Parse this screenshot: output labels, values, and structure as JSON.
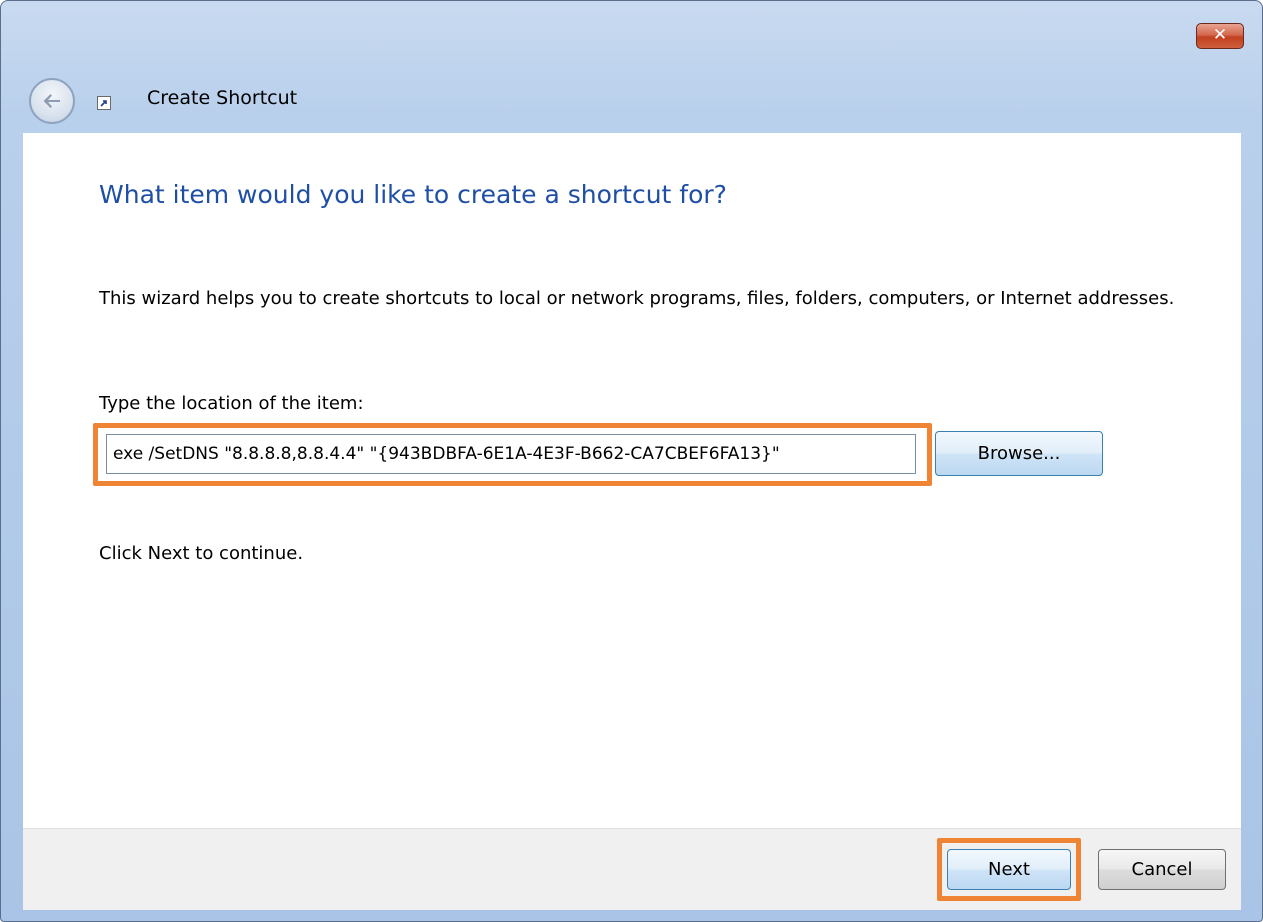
{
  "window": {
    "title": "Create Shortcut",
    "close_glyph": "✕",
    "icons": {
      "back": "back-arrow-icon",
      "title": "shortcut-icon",
      "close": "close-icon"
    }
  },
  "page": {
    "heading": "What item would you like to create a shortcut for?",
    "description": "This wizard helps you to create shortcuts to local or network programs, files, folders, computers, or Internet addresses.",
    "location_label": "Type the location of the item:",
    "location_value": "exe /SetDNS \"8.8.8.8,8.8.4.4\" \"{943BDBFA-6E1A-4E3F-B662-CA7CBEF6FA13}\"",
    "browse_label": "Browse...",
    "continue_text": "Click Next to continue."
  },
  "footer": {
    "next_label": "Next",
    "cancel_label": "Cancel"
  },
  "colors": {
    "heading": "#1f4fa5",
    "highlight": "#ee8434",
    "close_button": "#c2401f"
  }
}
